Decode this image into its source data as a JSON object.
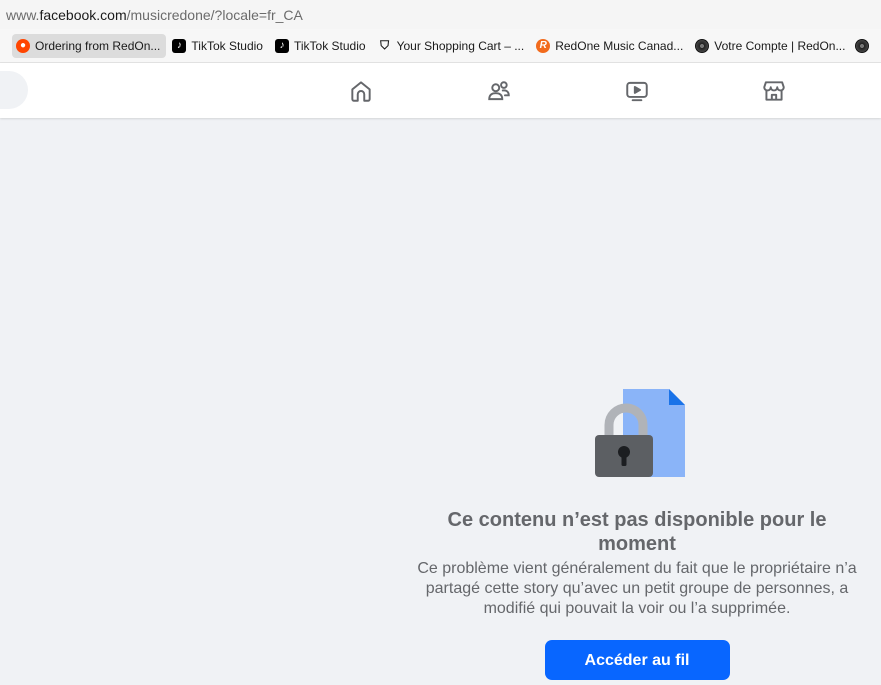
{
  "browser": {
    "url_prefix": "www.",
    "url_domain": "facebook.com",
    "url_path": "/musicredone/?locale=fr_CA"
  },
  "bookmarks": [
    {
      "label": "Ordering from RedOn...",
      "icon": "reddit-icon"
    },
    {
      "label": "TikTok Studio",
      "icon": "tiktok-icon"
    },
    {
      "label": "TikTok Studio",
      "icon": "tiktok-icon"
    },
    {
      "label": "Your Shopping Cart – ...",
      "icon": "shield-icon"
    },
    {
      "label": "RedOne Music Canad...",
      "icon": "redone-icon"
    },
    {
      "label": "Votre Compte | RedOn...",
      "icon": "vinyl-disc-icon"
    }
  ],
  "nav": {
    "items": [
      "home-icon",
      "friends-icon",
      "video-icon",
      "marketplace-icon"
    ]
  },
  "error": {
    "title": "Ce contenu n’est pas disponible pour le moment",
    "description": "Ce problème vient généralement du fait que le propriétaire n’a partagé cette story qu’avec un petit groupe de personnes, a modifié qui pouvait la voir ou l’a supprimée.",
    "button_label": "Accéder au fil"
  },
  "colors": {
    "accent": "#0866ff",
    "background": "#f0f2f5",
    "secondary_text": "#65676b"
  }
}
